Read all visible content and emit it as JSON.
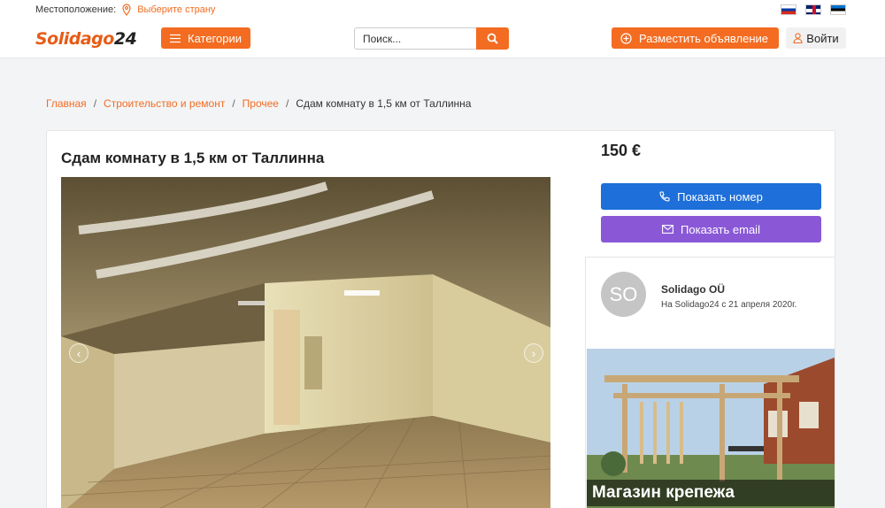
{
  "header": {
    "location_label": "Местоположение:",
    "location_link": "Выберите страну",
    "logo_left": "Solidago",
    "logo_right": "24",
    "categories_label": "Категории",
    "search_placeholder": "Поиск...",
    "post_ad_label": "Разместить объявление",
    "login_label": "Войти",
    "flags": [
      "ru",
      "gb",
      "ee"
    ]
  },
  "breadcrumb": {
    "items": [
      "Главная",
      "Строительство и ремонт",
      "Прочее"
    ],
    "current": "Сдам комнату в 1,5 км от Таллинна",
    "separator": "/"
  },
  "listing": {
    "title": "Сдам комнату в 1,5 км от Таллинна",
    "price": "150 €",
    "show_phone_label": "Показать номер",
    "show_email_label": "Показать email"
  },
  "seller": {
    "initials": "SO",
    "name": "Solidago OÜ",
    "since": "На Solidago24 с 21 апреля 2020г."
  },
  "ad": {
    "label": "Магазин крепежа"
  },
  "colors": {
    "accent": "#f36c21",
    "blue": "#1e6fd9",
    "purple": "#8a58d6"
  },
  "icons": {
    "location": "map-pin-icon",
    "categories": "list-icon",
    "search": "search-icon",
    "post": "plus-circle-icon",
    "login": "user-icon",
    "phone": "phone-icon",
    "email": "envelope-icon",
    "prev": "chevron-left-icon",
    "next": "chevron-right-icon"
  }
}
